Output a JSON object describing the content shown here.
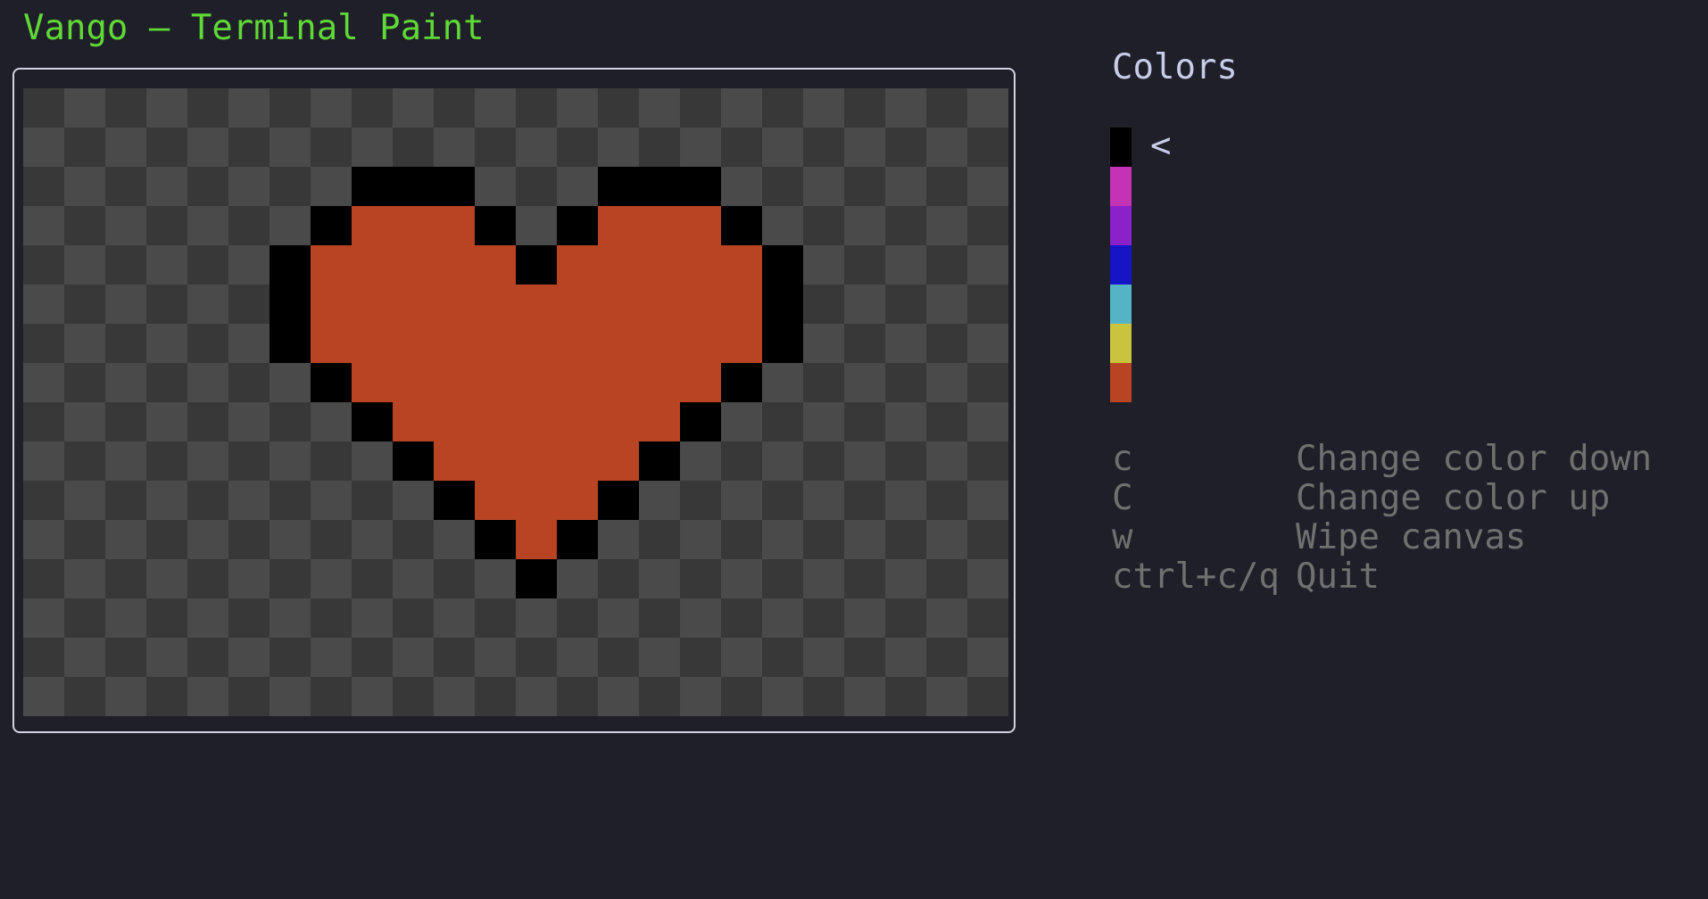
{
  "app": {
    "title": "Vango – Terminal Paint"
  },
  "palette": {
    "title": "Colors",
    "selected_index": 0,
    "selector_glyph": "<",
    "colors": [
      {
        "name": "black",
        "hex": "#000000"
      },
      {
        "name": "magenta",
        "hex": "#c533b5"
      },
      {
        "name": "purple",
        "hex": "#8a21c9"
      },
      {
        "name": "blue",
        "hex": "#1515c6"
      },
      {
        "name": "cyan",
        "hex": "#54b4c6"
      },
      {
        "name": "yellow",
        "hex": "#c8c43e"
      },
      {
        "name": "red-orange",
        "hex": "#b94424"
      }
    ]
  },
  "canvas": {
    "checker_light": "#4a4a4a",
    "checker_dark": "#383838",
    "legend": {
      ".": "transparent",
      "K": "#000000",
      "R": "#b94424"
    },
    "rows": [
      "........................",
      "........................",
      "........KKK...KKK.......",
      ".......KRRRK.KRRRK......",
      "......KRRRRRKRRRRRK.....",
      "......KRRRRRRRRRRRK.....",
      "......KRRRRRRRRRRRK.....",
      ".......KRRRRRRRRRK......",
      "........KRRRRRRRK.......",
      ".........KRRRRRK........",
      "..........KRRRK.........",
      "...........KRK..........",
      "............K...........",
      "........................",
      "........................",
      "........................"
    ]
  },
  "help": [
    {
      "key": "c",
      "desc": "Change color down"
    },
    {
      "key": "C",
      "desc": "Change color up"
    },
    {
      "key": "w",
      "desc": "Wipe canvas"
    },
    {
      "key": "ctrl+c/q",
      "desc": "Quit"
    }
  ]
}
